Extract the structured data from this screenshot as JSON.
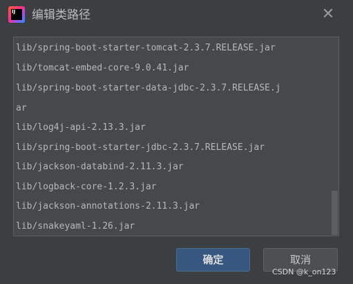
{
  "window": {
    "title": "编辑类路径",
    "close_glyph": "✕"
  },
  "app_icon": {
    "text": "IJ"
  },
  "classpath": {
    "lines": [
      "lib/spring-boot-starter-tomcat-2.3.7.RELEASE.jar",
      "lib/tomcat-embed-core-9.0.41.jar",
      "lib/spring-boot-starter-data-jdbc-2.3.7.RELEASE.j",
      "ar",
      "lib/log4j-api-2.13.3.jar",
      "lib/spring-boot-starter-jdbc-2.3.7.RELEASE.jar",
      "lib/jackson-databind-2.11.3.jar",
      "lib/logback-core-1.2.3.jar",
      "lib/jackson-annotations-2.11.3.jar",
      "lib/snakeyaml-1.26.jar"
    ]
  },
  "buttons": {
    "ok": "确定",
    "cancel": "取消"
  },
  "watermark": "CSDN @k_on123",
  "colors": {
    "background": "#3c3f41",
    "list_bg": "#45494a",
    "primary_button": "#365880"
  }
}
